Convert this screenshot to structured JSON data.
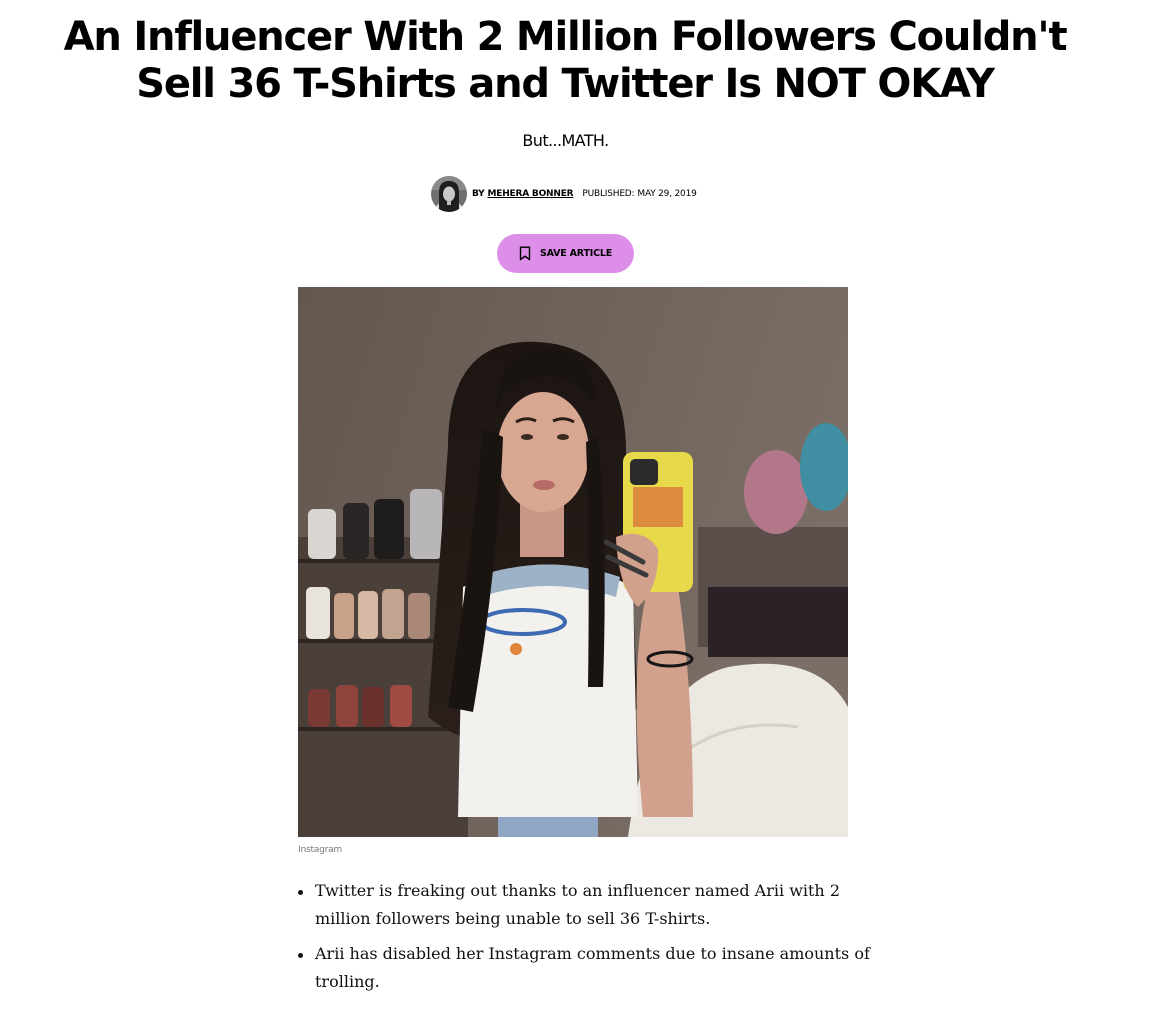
{
  "article": {
    "headline": "An Influencer With 2 Million Followers Couldn't Sell 36 T-Shirts and Twitter Is NOT OKAY",
    "dek": "But...MATH.",
    "byline": {
      "prefix": "BY",
      "author": "MEHERA BONNER",
      "published_label": "PUBLISHED:",
      "published_date": "MAY 29, 2019"
    },
    "save_button": {
      "label": "SAVE ARTICLE",
      "icon": "bookmark-icon"
    },
    "image": {
      "caption": "Instagram"
    },
    "summary": [
      "Twitter is freaking out thanks to an influencer named Arii with 2 million followers being unable to sell 36 T-shirts.",
      "Arii has disabled her Instagram comments due to insane amounts of trolling."
    ]
  },
  "colors": {
    "save_button_bg": "#dd8ee8",
    "text": "#000000",
    "caption_text": "#777777"
  }
}
